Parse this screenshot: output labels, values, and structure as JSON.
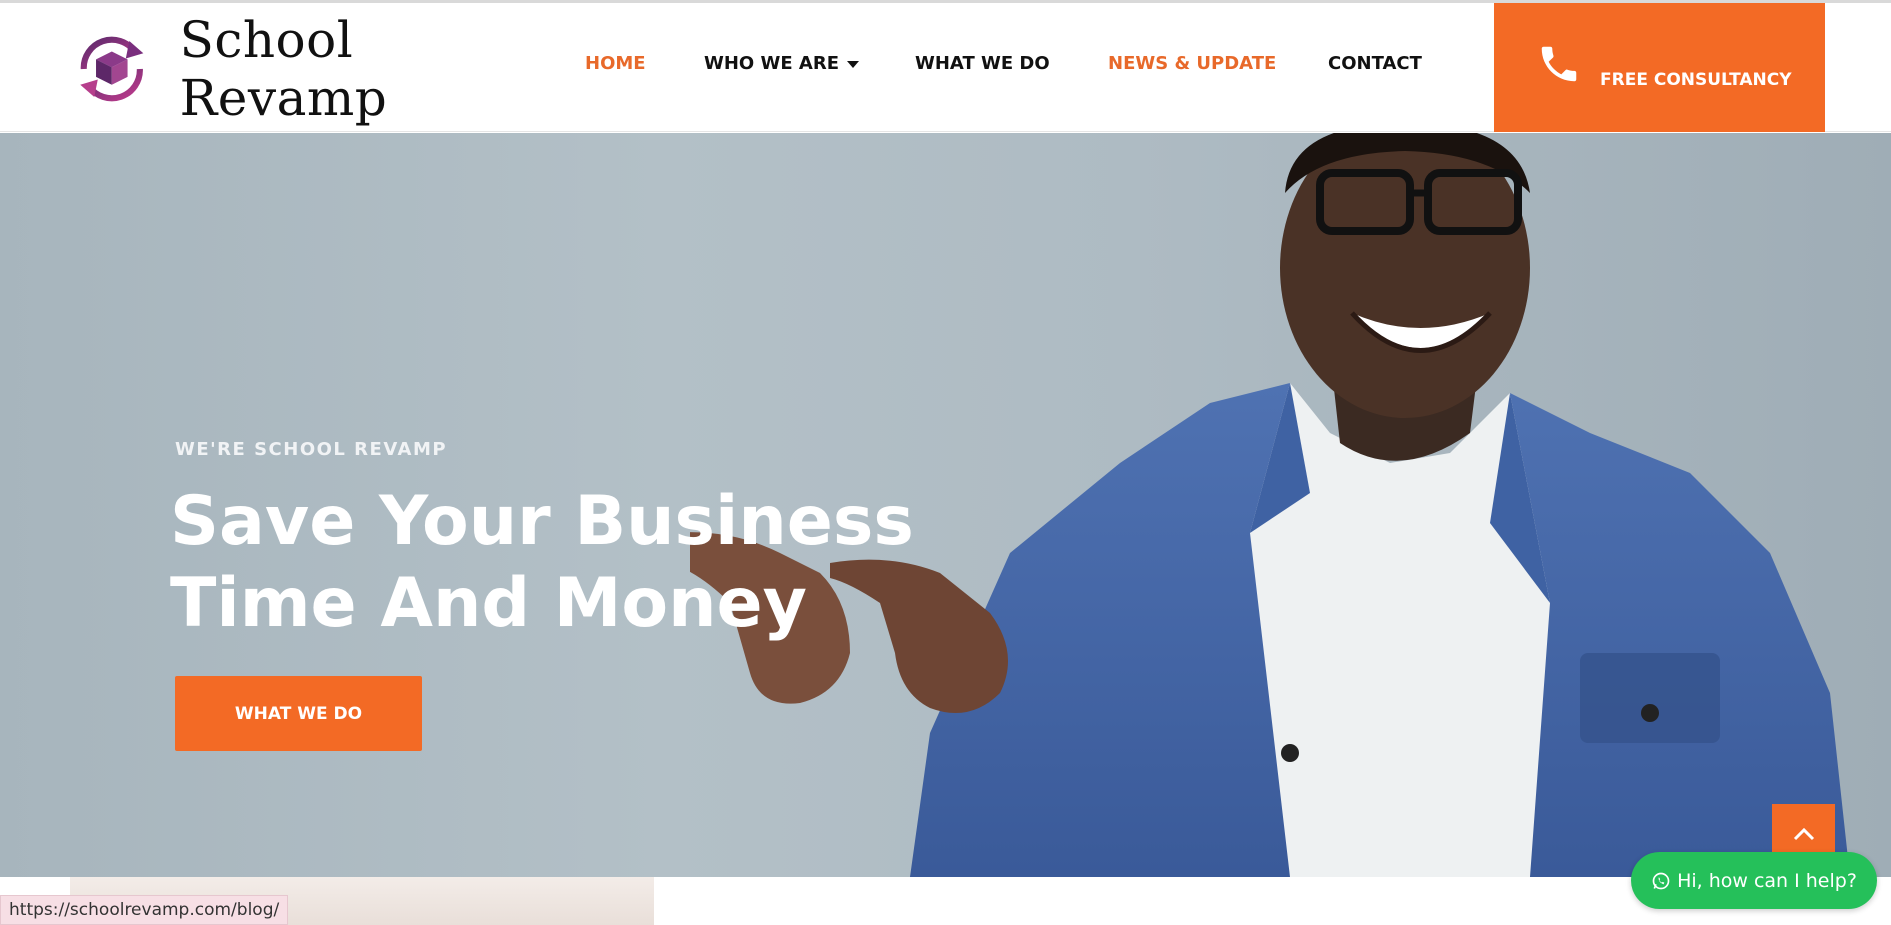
{
  "header": {
    "brand": "School Revamp",
    "nav": {
      "home": "HOME",
      "who_we_are": "WHO WE ARE",
      "what_we_do": "WHAT WE DO",
      "news": "NEWS & UPDATE",
      "contact": "CONTACT"
    },
    "cta_label": "FREE CONSULTANCY"
  },
  "hero": {
    "kicker": "WE'RE SCHOOL REVAMP",
    "headline": "Save Your Business Time And Money",
    "button": "WHAT WE DO"
  },
  "status_url": "https://schoolrevamp.com/blog/",
  "chat_label": "Hi, how can I help?",
  "colors": {
    "accent": "#f36a25",
    "nav_active": "#e8692a",
    "chat": "#25c05a"
  },
  "icons": {
    "logo": "box-cycle-icon",
    "cta": "phone-icon",
    "dropdown": "caret-down-icon",
    "scroll_top": "chevron-up-icon",
    "chat": "whatsapp-icon"
  }
}
